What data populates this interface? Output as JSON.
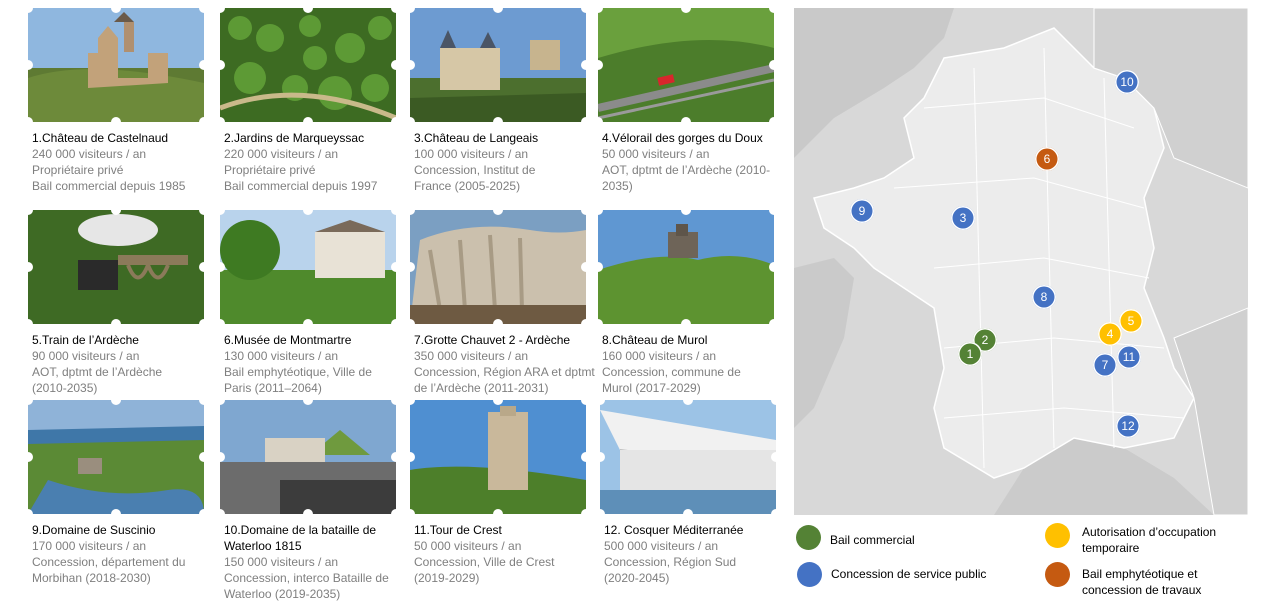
{
  "cards": [
    {
      "title": "1.Château  de Castelnaud",
      "lines": [
        "240 000 visiteurs  / an",
        "Propriétaire  privé",
        "Bail commercial depuis 1985"
      ]
    },
    {
      "title": "2.Jardins de Marqueyssac",
      "lines": [
        "220 000 visiteurs  / an",
        "Propriétaire  privé",
        "Bail commercial depuis 1997"
      ]
    },
    {
      "title": "3.Château  de Langeais",
      "lines": [
        "100 000 visiteurs  / an",
        "Concession,  Institut de",
        "France  (2005-2025)"
      ]
    },
    {
      "title": "4.Vélorail des gorges du Doux",
      "lines": [
        "50 000 visiteurs  / an",
        "AOT,  dptmt de l’Ardèche  (2010-",
        "2035)"
      ]
    },
    {
      "title": "5.Train  de l’Ardèche",
      "lines": [
        "90 000 visiteurs  / an",
        "AOT,  dptmt de l’Ardèche",
        "(2010-2035)"
      ]
    },
    {
      "title": "6.Musée de Montmartre",
      "lines": [
        "130 000 visiteurs  / an",
        "Bail emphytéotique,  Ville de",
        "Paris  (2011–2064)"
      ]
    },
    {
      "title": "7.Grotte Chauvet  2 - Ardèche",
      "lines": [
        "350 000 visiteurs  / an",
        "Concession,  Région ARA et dptmt",
        "de l’Ardèche  (2011-2031)"
      ]
    },
    {
      "title": "8.Château  de Murol",
      "lines": [
        "160 000 visiteurs  / an",
        "Concession,  commune de",
        "Murol  (2017-2029)"
      ]
    },
    {
      "title": "9.Domaine  de Suscinio",
      "lines": [
        "170 000 visiteurs  / an",
        "Concession,  département  du",
        "Morbihan  (2018-2030)"
      ]
    },
    {
      "title": "10.Domaine de la bataille de Waterloo 1815",
      "lines": [
        "150 000 visiteurs  / an",
        "Concession,  interco Bataille de",
        "Waterloo  (2019-2035)"
      ]
    },
    {
      "title": "11.Tour de Crest",
      "lines": [
        "50 000 visiteurs  / an",
        "Concession,  Ville de Crest",
        "(2019-2029)"
      ]
    },
    {
      "title": "12. Cosquer  Méditerranée",
      "lines": [
        "500 000 visiteurs  / an",
        "Concession,  Région Sud",
        "(2020-2045)"
      ]
    }
  ],
  "map_markers": [
    {
      "label": "1",
      "type": "bail-commercial"
    },
    {
      "label": "2",
      "type": "bail-commercial"
    },
    {
      "label": "3",
      "type": "concession"
    },
    {
      "label": "4",
      "type": "aot"
    },
    {
      "label": "5",
      "type": "aot"
    },
    {
      "label": "6",
      "type": "emphyteotique"
    },
    {
      "label": "7",
      "type": "concession"
    },
    {
      "label": "8",
      "type": "concession"
    },
    {
      "label": "9",
      "type": "concession"
    },
    {
      "label": "10",
      "type": "concession"
    },
    {
      "label": "11",
      "type": "concession"
    },
    {
      "label": "12",
      "type": "concession"
    }
  ],
  "legend": {
    "bail_commercial": "Bail commercial",
    "concession": "Concession de service public",
    "aot": "Autorisation d’occupation temporaire",
    "emphyteotique": "Bail emphytéotique et concession de travaux"
  },
  "colors": {
    "bail-commercial": "#548235",
    "concession": "#4472c4",
    "aot": "#ffc000",
    "emphyteotique": "#c55a11"
  }
}
